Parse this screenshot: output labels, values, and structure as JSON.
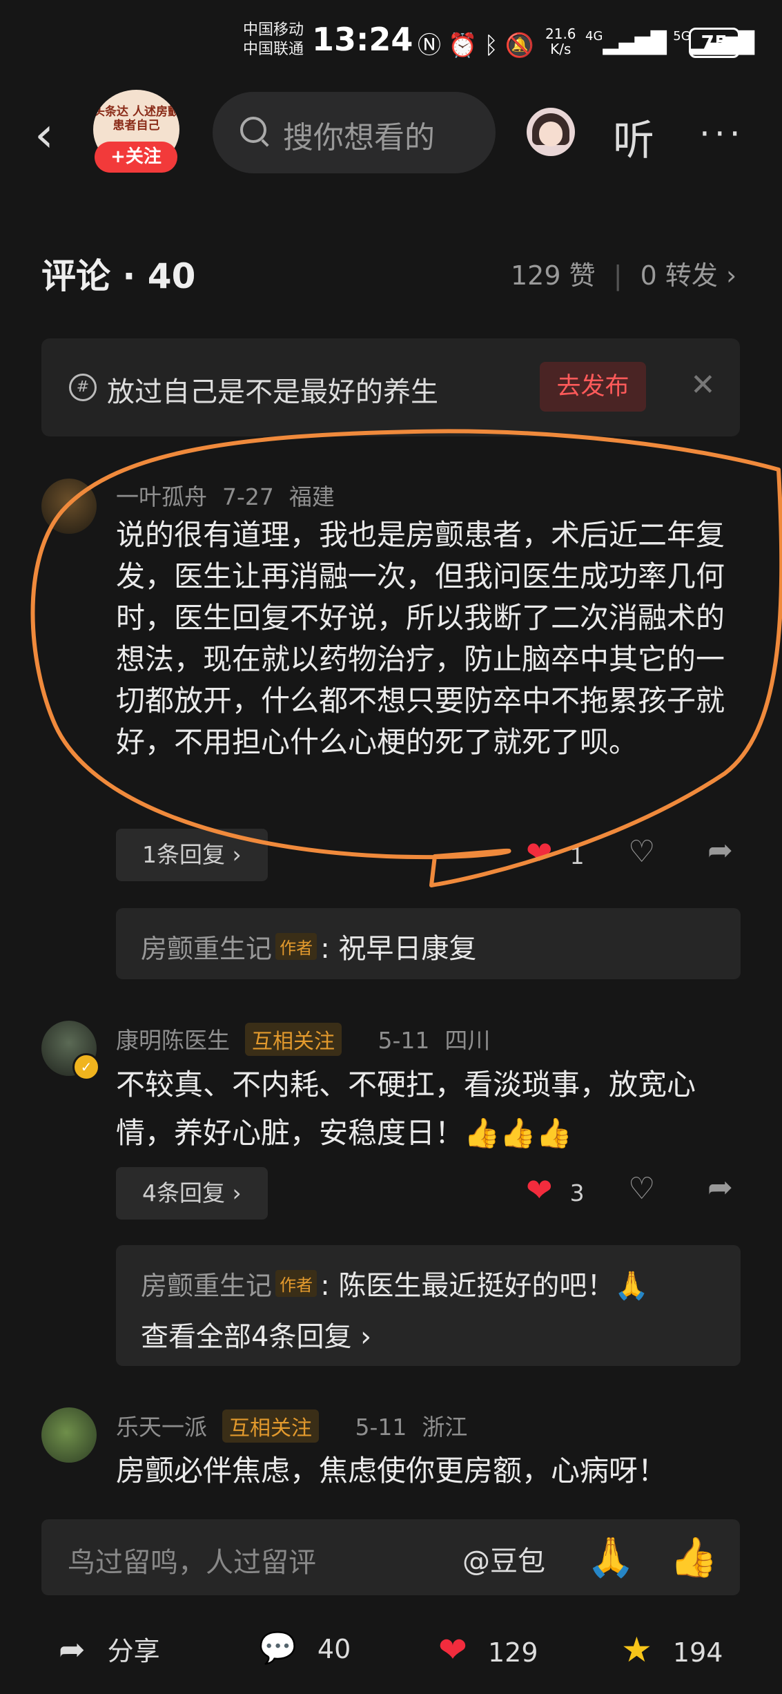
{
  "status": {
    "carrier1": "中国移动",
    "carrier2": "中国联通",
    "time": "13:24",
    "net_speed": "21.6",
    "net_unit": "K/s",
    "signal1": "4G",
    "signal2": "5G",
    "battery": "75"
  },
  "header": {
    "avatar_text": "头条达 人述房颤 患者自己",
    "follow": "+关注",
    "search_placeholder": "搜你想看的",
    "listen": "听",
    "more": "···"
  },
  "comments_header": {
    "title": "评论 · 40",
    "likes": "129 赞",
    "separator": "|",
    "shares": "0 转发"
  },
  "prompt": {
    "text": "放过自己是不是最好的养生",
    "publish": "去发布",
    "close": "✕"
  },
  "comments": [
    {
      "user": "一叶孤舟",
      "date": "7-27",
      "region": "福建",
      "text": "说的很有道理，我也是房颤患者，术后近二年复发，医生让再消融一次，但我问医生成功率几何时，医生回复不好说，所以我断了二次消融术的想法，现在就以药物治疗，防止脑卒中其它的一切都放开，什么都不想只要防卒中不拖累孩子就好，不用担心什么心梗的死了就死了呗。",
      "replies_btn": "1条回复 ›",
      "likes": "1",
      "reply_user": "房颤重生记",
      "reply_tag": "作者",
      "reply_text": ": 祝早日康复"
    },
    {
      "user": "康明陈医生",
      "tag": "互相关注",
      "date": "5-11",
      "region": "四川",
      "text": "不较真、不内耗、不硬扛，看淡琐事，放宽心情，养好心脏，安稳度日！👍👍👍",
      "replies_btn": "4条回复 ›",
      "likes": "3",
      "reply_user": "房颤重生记",
      "reply_tag": "作者",
      "reply_text": ": 陈医生最近挺好的吧！🙏",
      "view_all": "查看全部4条回复 ›"
    },
    {
      "user": "乐天一派",
      "tag": "互相关注",
      "date": "5-11",
      "region": "浙江",
      "text": "房颤必伴焦虑，焦虑使你更房额，心病呀！"
    }
  ],
  "input": {
    "placeholder": "鸟过留鸣，人过留评",
    "mention": "@豆包",
    "emoji1": "🙏",
    "emoji2": "👍"
  },
  "bottom": {
    "share": "分享",
    "comments": "40",
    "likes": "129",
    "favorites": "194"
  },
  "colors": {
    "accent": "#f22c3d",
    "annotation": "#f08a3c",
    "tag": "#e39a2d"
  }
}
